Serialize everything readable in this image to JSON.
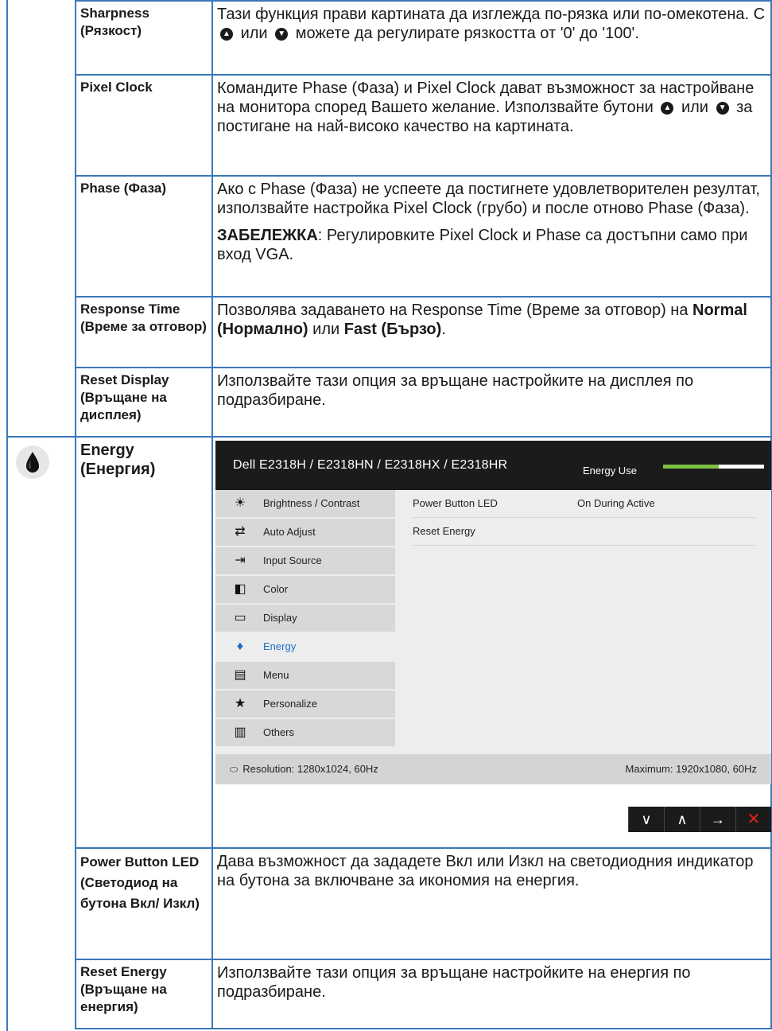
{
  "rows": {
    "sharpness": {
      "name": "Sharpness (Рязкост)",
      "desc_a": "Тази функция прави картината да изглежда по-рязка или по-омекотена. С",
      "desc_b": "или",
      "desc_c": "можете да регулирате рязкостта от '0' до '100'."
    },
    "pixel_clock": {
      "name": "Pixel Clock",
      "desc_a": "Командите Phase (Фаза) и Pixel Clock дават възможност за настройване на монитора според Вашето желание. Използвайте бутони",
      "desc_b": "или",
      "desc_c": "за постигане на най-високо качество на картината."
    },
    "phase": {
      "name": "Phase (Фаза)",
      "desc": "Ако с Phase (Фаза) не успеете да постигнете удовлетворителен резултат, използвайте настройка Pixel Clock (грубо) и после отново Phase (Фаза).",
      "note_label": "ЗАБЕЛЕЖКА",
      "note_text": ": Регулировките Pixel Clock и Phase са достъпни само при вход VGA."
    },
    "response_time": {
      "name": "Response Time (Време за отговор)",
      "desc_a": "Позволява задаването на Response Time (Време за отговор) на",
      "opt1": "Normal (Нормално)",
      "desc_b": "или",
      "opt2": "Fast (Бързо)",
      "desc_c": "."
    },
    "reset_display": {
      "name": "Reset Display (Връщане на дисплея)",
      "desc": "Използвайте тази опция за връщане настройките на дисплея по подразбиране."
    },
    "energy": {
      "name": "Energy (Енергия)",
      "icon": "energy-flame-icon"
    },
    "power_button_led": {
      "name": "Power Button LED (Светодиод на бутона Вкл/ Изкл)",
      "desc": "Дава възможност да зададете Вкл или Изкл на светодиодния индикатор на бутона за включване за икономия на енергия."
    },
    "reset_energy": {
      "name": "Reset Energy (Връщане на енергия)",
      "desc": "Използвайте тази опция за връщане настройките на енергия по подразбиране."
    }
  },
  "osd": {
    "model": "Dell E2318H / E2318HN / E2318HX / E2318HR",
    "energy_use_label": "Energy Use",
    "energy_use_level": 0.55,
    "menu": [
      {
        "label": "Brightness / Contrast",
        "icon": "brightness-icon"
      },
      {
        "label": "Auto Adjust",
        "icon": "auto-adjust-icon"
      },
      {
        "label": "Input Source",
        "icon": "input-source-icon"
      },
      {
        "label": "Color",
        "icon": "color-icon"
      },
      {
        "label": "Display",
        "icon": "display-icon"
      },
      {
        "label": "Energy",
        "icon": "energy-icon",
        "active": true
      },
      {
        "label": "Menu",
        "icon": "menu-icon"
      },
      {
        "label": "Personalize",
        "icon": "star-icon"
      },
      {
        "label": "Others",
        "icon": "others-icon"
      }
    ],
    "options": [
      {
        "label": "Power Button LED",
        "value": "On During Active"
      },
      {
        "label": "Reset Energy",
        "value": ""
      }
    ],
    "resolution": "Resolution: 1280x1024, 60Hz",
    "maximum": "Maximum: 1920x1080, 60Hz",
    "buttons": [
      "down",
      "up",
      "right",
      "exit"
    ]
  }
}
